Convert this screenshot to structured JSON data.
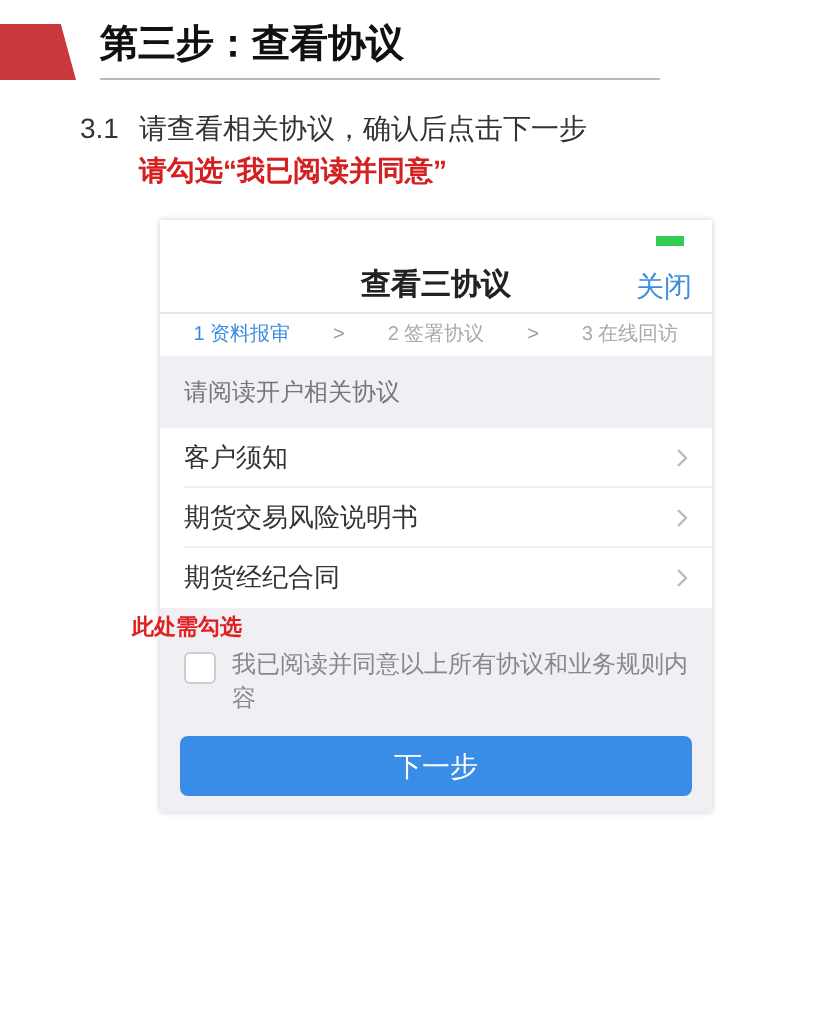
{
  "slide": {
    "title": "第三步：查看协议",
    "instruction": {
      "number": "3.1",
      "text": "请查看相关协议，确认后点击下一步",
      "note": "请勾选“我已阅读并同意”"
    }
  },
  "phone": {
    "title": "查看三协议",
    "close": "关闭",
    "steps": [
      {
        "label": "1 资料报审",
        "selected": true
      },
      {
        "label": "2 签署协议",
        "selected": false
      },
      {
        "label": "3 在线回访",
        "selected": false
      }
    ],
    "step_separator": ">",
    "section_label": "请阅读开户相关协议",
    "agreements": [
      {
        "label": "客户须知"
      },
      {
        "label": "期货交易风险说明书"
      },
      {
        "label": "期货经纪合同"
      }
    ],
    "annotation": "此处需勾选",
    "consent": {
      "label": "我已阅读并同意以上所有协议和业务规则内容",
      "checked": false
    },
    "next_button": "下一步"
  }
}
